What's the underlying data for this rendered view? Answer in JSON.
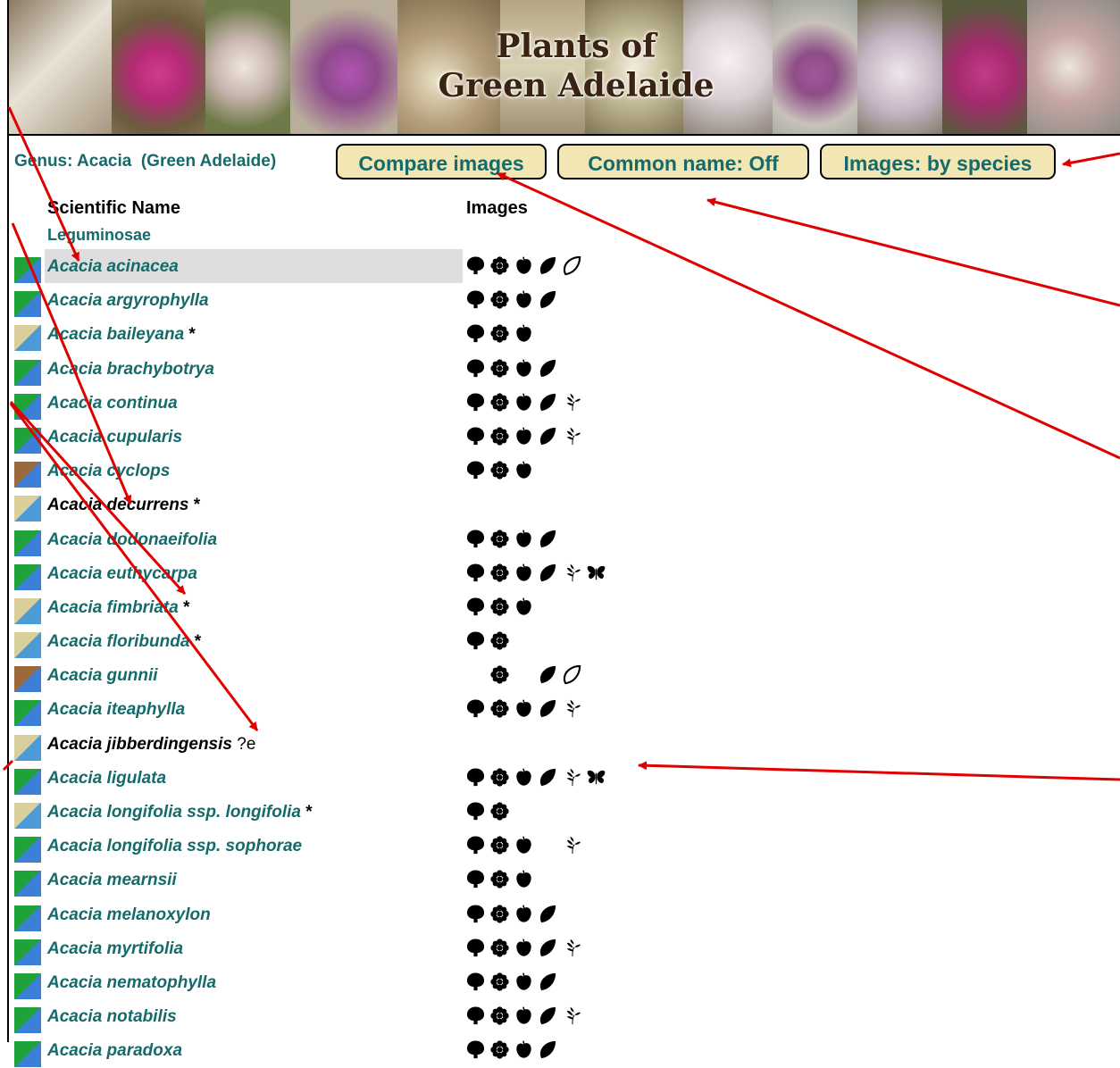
{
  "banner": {
    "title_line1": "Plants of",
    "title_line2": "Green Adelaide"
  },
  "toolbar": {
    "genus_label": "Genus: Acacia  (Green Adelaide)",
    "compare_button": "Compare images",
    "common_name_button": "Common name: Off",
    "images_button": "Images: by species"
  },
  "table": {
    "headers": {
      "scientific_name": "Scientific Name",
      "images": "Images"
    },
    "family": "Leguminosae",
    "rows": [
      {
        "name": "Acacia acinacea",
        "suffix": "",
        "map": "green",
        "icons": [
          "shrub",
          "flower",
          "fruit",
          "leaf",
          "leaf-outline"
        ],
        "highlighted": true
      },
      {
        "name": "Acacia argyrophylla",
        "suffix": "",
        "map": "green",
        "icons": [
          "shrub",
          "flower",
          "fruit",
          "leaf"
        ]
      },
      {
        "name": "Acacia baileyana",
        "suffix": " *",
        "map": "tan",
        "icons": [
          "shrub",
          "flower",
          "fruit"
        ]
      },
      {
        "name": "Acacia brachybotrya",
        "suffix": "",
        "map": "green",
        "icons": [
          "shrub",
          "flower",
          "fruit",
          "leaf"
        ]
      },
      {
        "name": "Acacia continua",
        "suffix": "",
        "map": "green",
        "icons": [
          "shrub",
          "flower",
          "fruit",
          "leaf",
          "seedling"
        ]
      },
      {
        "name": "Acacia cupularis",
        "suffix": "",
        "map": "green",
        "icons": [
          "shrub",
          "flower",
          "fruit",
          "leaf",
          "seedling"
        ]
      },
      {
        "name": "Acacia cyclops",
        "suffix": "",
        "map": "brown",
        "icons": [
          "shrub",
          "flower",
          "fruit"
        ]
      },
      {
        "name": "Acacia decurrens",
        "suffix": " *",
        "map": "tan",
        "black": true,
        "icons": []
      },
      {
        "name": "Acacia dodonaeifolia",
        "suffix": "",
        "map": "green",
        "icons": [
          "shrub",
          "flower",
          "fruit",
          "leaf"
        ]
      },
      {
        "name": "Acacia euthycarpa",
        "suffix": "",
        "map": "green",
        "icons": [
          "shrub",
          "flower",
          "fruit",
          "leaf",
          "seedling",
          "butterfly"
        ]
      },
      {
        "name": "Acacia fimbriata",
        "suffix": " *",
        "map": "tan",
        "icons": [
          "shrub",
          "flower",
          "fruit"
        ]
      },
      {
        "name": "Acacia floribunda",
        "suffix": " *",
        "map": "tan",
        "icons": [
          "shrub",
          "flower"
        ]
      },
      {
        "name": "Acacia gunnii",
        "suffix": "",
        "map": "brown",
        "icons": [
          "blank",
          "flower",
          "blank",
          "leaf",
          "leaf-outline"
        ]
      },
      {
        "name": "Acacia iteaphylla",
        "suffix": "",
        "map": "green",
        "icons": [
          "shrub",
          "flower",
          "fruit",
          "leaf",
          "seedling"
        ]
      },
      {
        "name": "Acacia jibberdingensis",
        "suffix": " ?e",
        "map": "tan",
        "black": true,
        "plain_suffix": true,
        "icons": []
      },
      {
        "name": "Acacia ligulata",
        "suffix": "",
        "map": "green",
        "icons": [
          "shrub",
          "flower",
          "fruit",
          "leaf",
          "seedling",
          "butterfly"
        ]
      },
      {
        "name": "Acacia longifolia ssp. longifolia",
        "suffix": " *",
        "map": "tan",
        "icons": [
          "shrub",
          "flower"
        ]
      },
      {
        "name": "Acacia longifolia ssp. sophorae",
        "suffix": "",
        "map": "green",
        "icons": [
          "shrub",
          "flower",
          "fruit",
          "blank",
          "seedling"
        ]
      },
      {
        "name": "Acacia mearnsii",
        "suffix": "",
        "map": "green",
        "icons": [
          "shrub",
          "flower",
          "fruit"
        ]
      },
      {
        "name": "Acacia melanoxylon",
        "suffix": "",
        "map": "green",
        "icons": [
          "shrub",
          "flower",
          "fruit",
          "leaf"
        ]
      },
      {
        "name": "Acacia myrtifolia",
        "suffix": "",
        "map": "green",
        "icons": [
          "shrub",
          "flower",
          "fruit",
          "leaf",
          "seedling"
        ]
      },
      {
        "name": "Acacia nematophylla",
        "suffix": "",
        "map": "green",
        "icons": [
          "shrub",
          "flower",
          "fruit",
          "leaf"
        ]
      },
      {
        "name": "Acacia notabilis",
        "suffix": "",
        "map": "green",
        "icons": [
          "shrub",
          "flower",
          "fruit",
          "leaf",
          "seedling"
        ]
      },
      {
        "name": "Acacia paradoxa",
        "suffix": "",
        "map": "green",
        "icons": [
          "shrub",
          "flower",
          "fruit",
          "leaf"
        ]
      }
    ]
  },
  "colors": {
    "link_teal": "#166a6a",
    "button_fill": "#f1e6b4",
    "highlight": "#dedede",
    "annotation_red": "#e00000"
  }
}
